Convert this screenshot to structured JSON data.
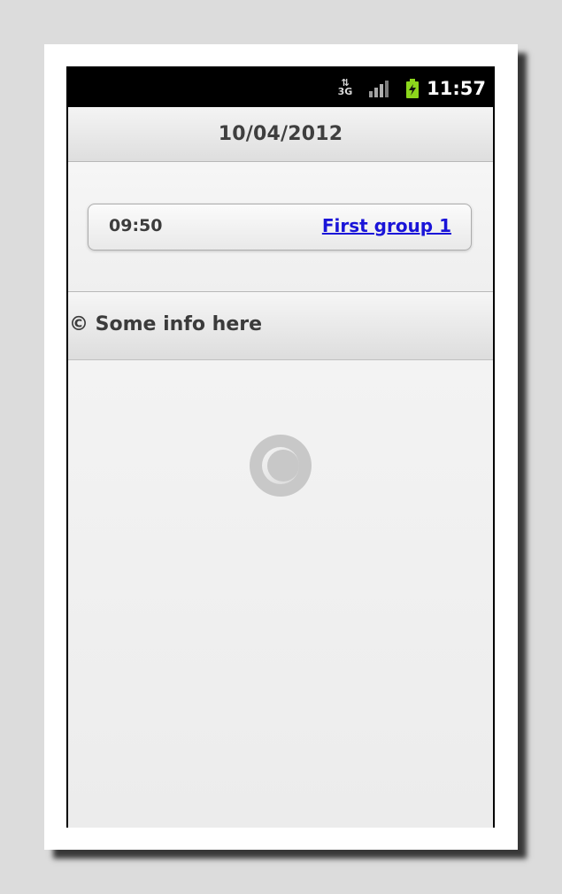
{
  "status_bar": {
    "network_icon": "3g-data-icon",
    "signal_icon": "signal-strength-icon",
    "battery_icon": "battery-charging-icon",
    "time": "11:57"
  },
  "header": {
    "title": "10/04/2012"
  },
  "entries": [
    {
      "time": "09:50",
      "link": "First group 1"
    }
  ],
  "footer": {
    "text": "© Some info here"
  },
  "loading": {
    "icon": "loading-spinner-icon"
  },
  "colors": {
    "link": "#1a14d8",
    "text": "#3f3f3f",
    "background": "#f2f2f2"
  }
}
